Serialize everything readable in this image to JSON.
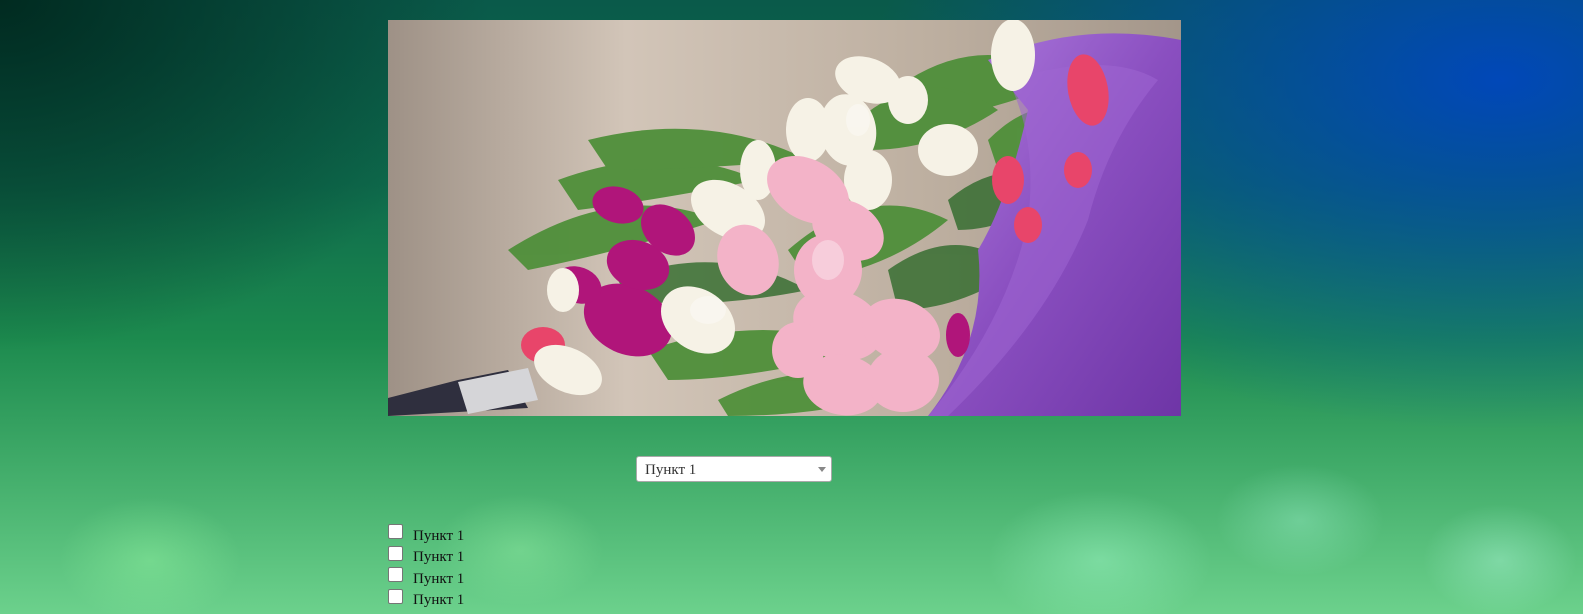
{
  "hero_image": {
    "subject": "bouquet of pink, white and magenta tulips wrapped in purple paper",
    "colors": {
      "background": "#c2b5a8",
      "wrap": "#8a4fc0",
      "leaf": "#4f8f3a",
      "tulip_pink": "#f3b3c8",
      "tulip_white": "#f6f2e6",
      "tulip_magenta": "#b0157a",
      "tulip_red": "#e8456a"
    }
  },
  "dropdown": {
    "selected": "Пункт 1",
    "arrow_icon": "chevron-down-icon"
  },
  "checklist": [
    {
      "label": "Пункт 1",
      "checked": false
    },
    {
      "label": "Пункт 1",
      "checked": false
    },
    {
      "label": "Пункт 1",
      "checked": false
    },
    {
      "label": "Пункт 1",
      "checked": false
    }
  ]
}
